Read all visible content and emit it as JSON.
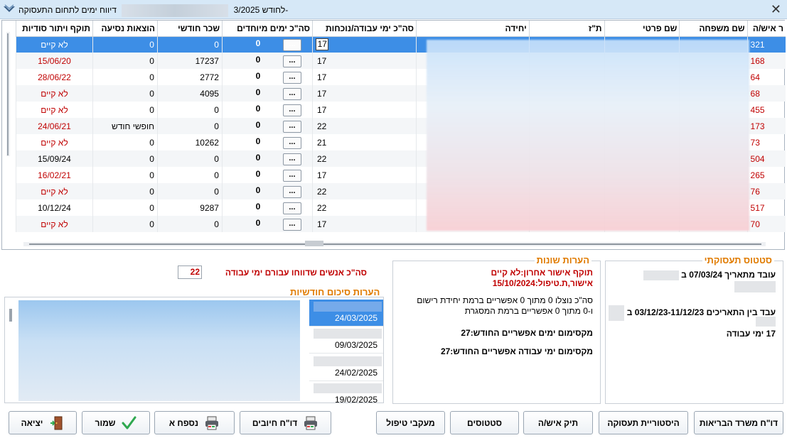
{
  "window": {
    "title_main": "דיווח ימים לתחום התעסוקה-",
    "title_suffix": "לחודש 3/2025"
  },
  "grid": {
    "columns": [
      "ר איש/ה",
      "שם משפחה",
      "שם פרטי",
      "ת\"ז",
      "יחידה",
      "סה\"כ ימי עבודה/נוכחות",
      "סה\"כ ימים מיוחדים",
      "שכר חודשי",
      "הוצאות נסיעה",
      "תוקף ויתור סודיות"
    ],
    "rows": [
      {
        "id": "321",
        "days": "17",
        "special": "0",
        "salary": "0",
        "travel": "0",
        "validity": "לא קיים",
        "validity_red": true,
        "selected": true
      },
      {
        "id": "168",
        "days": "17",
        "special": "0",
        "salary": "17237",
        "travel": "0",
        "validity": "15/06/20",
        "validity_red": true
      },
      {
        "id": "64",
        "days": "17",
        "special": "0",
        "salary": "2772",
        "travel": "0",
        "validity": "28/06/22",
        "validity_red": true
      },
      {
        "id": "68",
        "days": "17",
        "special": "0",
        "salary": "4095",
        "travel": "0",
        "validity": "לא קיים",
        "validity_red": true
      },
      {
        "id": "455",
        "days": "17",
        "special": "0",
        "salary": "0",
        "travel": "0",
        "validity": "לא קיים",
        "validity_red": true
      },
      {
        "id": "173",
        "days": "22",
        "special": "0",
        "salary": "0",
        "travel": "חופשי חודש",
        "validity": "24/06/21",
        "validity_red": true
      },
      {
        "id": "73",
        "days": "21",
        "special": "0",
        "salary": "10262",
        "travel": "0",
        "validity": "לא קיים",
        "validity_red": true
      },
      {
        "id": "504",
        "days": "22",
        "special": "0",
        "salary": "0",
        "travel": "0",
        "validity": "15/09/24",
        "validity_red": false
      },
      {
        "id": "265",
        "days": "17",
        "special": "0",
        "salary": "0",
        "travel": "0",
        "validity": "16/02/21",
        "validity_red": true
      },
      {
        "id": "76",
        "days": "22",
        "special": "0",
        "salary": "0",
        "travel": "0",
        "validity": "לא קיים",
        "validity_red": true
      },
      {
        "id": "517",
        "days": "22",
        "special": "0",
        "salary": "9287",
        "travel": "0",
        "validity": "10/12/24",
        "validity_red": false
      },
      {
        "id": "70",
        "days": "17",
        "special": "0",
        "salary": "0",
        "travel": "0",
        "validity": "לא קיים",
        "validity_red": true
      }
    ],
    "row_button": "..."
  },
  "summary": {
    "count_label": "סה\"כ אנשים שדווחו עבורם ימי עבודה",
    "count_value": "22"
  },
  "status": {
    "title": "סטטוס תעסוקתי",
    "line1": "עובד מתאריך 07/03/24 ב",
    "line2": "עבד בין התאריכים 03/12/23-11/12/23 ב",
    "line3": "17 ימי עבודה"
  },
  "notes": {
    "title": "הערות שונות",
    "line1": "תוקף אישור אחרון:לא קיים",
    "line2": "אישור,ת.טיפול:15/10/2024",
    "line3": "סה\"כ נוצלו 0 מתוך 0 אפשריים ברמת יחידת רישום",
    "line4": "ו-0 מתוך 0  אפשריים ברמת המסגרת",
    "line5": "מקסימום ימים אפשריים החודש:27",
    "line6": "מקסימום ימי עבודה אפשריים החודש:27"
  },
  "monthly": {
    "title": "הערות סיכום חודשיות",
    "dates": [
      "24/03/2025",
      "09/03/2025",
      "24/02/2025",
      "19/02/2025"
    ]
  },
  "buttons": {
    "health_report": "דו\"ח משרד הבריאות",
    "employment_history": "היסטוריית תעסוקה",
    "person_file": "תיק איש/ה",
    "statuses": "סטטוסים",
    "care_tracking": "מעקבי טיפול",
    "charges_report": "דו\"ח חיובים",
    "appendix_a": "נספח א",
    "save": "שמור",
    "exit": "יציאה"
  }
}
